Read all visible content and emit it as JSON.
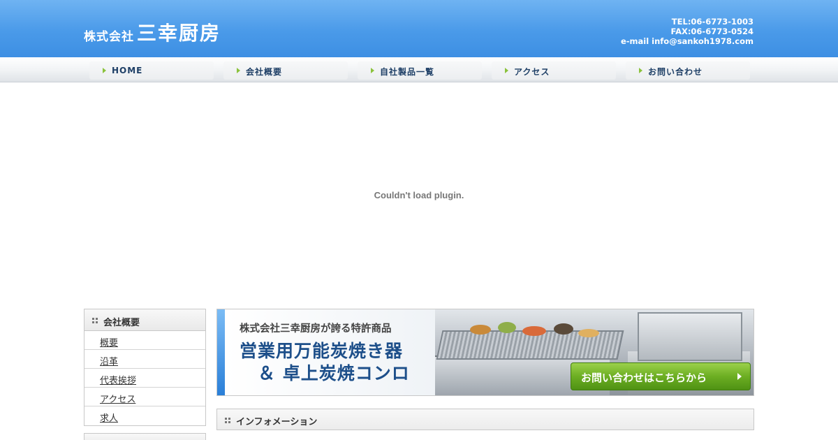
{
  "header": {
    "logo_prefix": "株式会社",
    "logo_name": "三幸厨房",
    "tel": "TEL:06-6773-1003",
    "fax": "FAX:06-6773-0524",
    "email": "e-mail info@sankoh1978.com"
  },
  "nav": {
    "items": [
      {
        "label": "HOME"
      },
      {
        "label": "会社概要"
      },
      {
        "label": "自社製品一覧"
      },
      {
        "label": "アクセス"
      },
      {
        "label": "お問い合わせ"
      }
    ]
  },
  "plugin": {
    "message": "Couldn't load plugin."
  },
  "sidebar": {
    "title": "会社概要",
    "links": [
      {
        "label": "概要"
      },
      {
        "label": "沿革"
      },
      {
        "label": "代表挨拶"
      },
      {
        "label": "アクセス"
      },
      {
        "label": "求人"
      }
    ]
  },
  "banner": {
    "subtitle": "株式会社三幸厨房が誇る特許商品",
    "title_line1": "営業用万能炭焼き器",
    "title_line2": "＆ 卓上炭焼コンロ",
    "cta_label": "お問い合わせはこちらから"
  },
  "info": {
    "title": "インフォメーション"
  },
  "colors": {
    "header_blue": "#4a9ae9",
    "nav_text": "#1e3f66",
    "nav_arrow": "#8bc23c",
    "banner_title": "#1d4f8a",
    "cta_green": "#6cae22"
  },
  "icons": {
    "nav_arrow": "triangle-right-icon",
    "section_bullet": "grid-icon"
  }
}
